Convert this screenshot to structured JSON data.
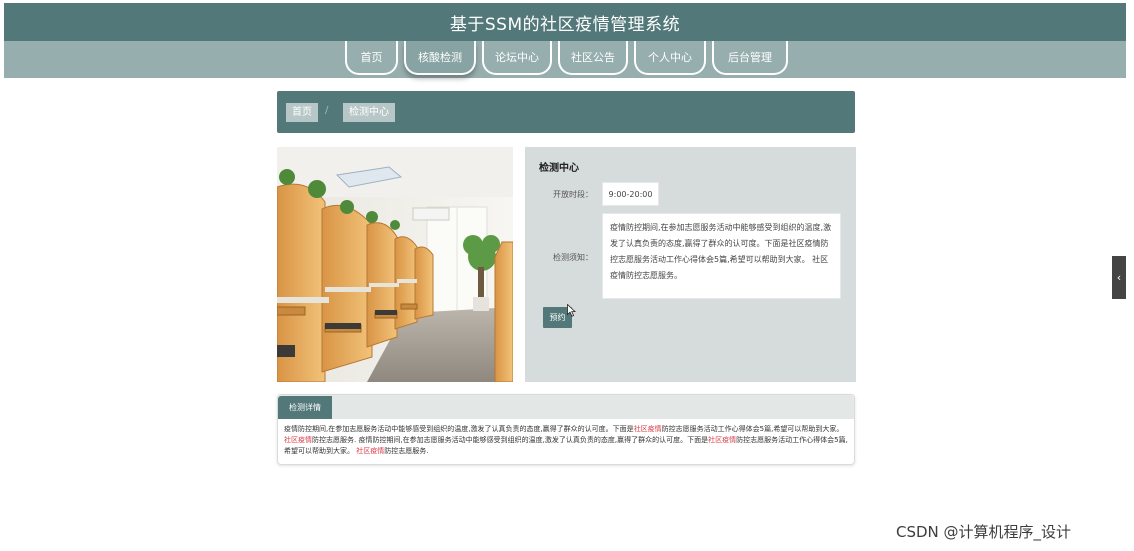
{
  "header": {
    "title": "基于SSM的社区疫情管理系统"
  },
  "nav": {
    "items": [
      {
        "label": "首页",
        "active": false
      },
      {
        "label": "核酸检测",
        "active": true
      },
      {
        "label": "论坛中心",
        "active": false
      },
      {
        "label": "社区公告",
        "active": false
      },
      {
        "label": "个人中心",
        "active": false
      },
      {
        "label": "后台管理",
        "active": false
      }
    ]
  },
  "breadcrumb": {
    "home": "首页",
    "separator": "/",
    "current": "检测中心"
  },
  "info": {
    "title": "检测中心",
    "hours_label": "开放时段：",
    "hours_value": "9:00-20:00",
    "notice_label": "检测须知：",
    "notice_value": "疫情防控期间,在参加志愿服务活动中能够感受到组织的温度,激发了认真负责的态度,赢得了群众的认可度。下面是社区疫情防控志愿服务活动工作心得体会5篇,希望可以帮助到大家。 社区疫情防控志愿服务。",
    "book_button": "预约"
  },
  "detail": {
    "tab_label": "检测详情",
    "segments": [
      "疫情防控期间,在参加志愿服务活动中能够感受到组织的温度,激发了认真负责的态度,赢得了群众的认可度。下面是",
      "社区疫情",
      "防控志愿服务活动工作心得体会5篇,希望可以帮助到大家。 ",
      "社区疫情",
      "防控志愿服务. 疫情防控期间,在参加志愿服务活动中能够感受到组织的温度,激发了认真负责的态度,赢得了群众的认可度。下面是",
      "社区疫情",
      "防控志愿服务活动工作心得体会5篇,希望可以帮助到大家。 ",
      "社区疫情",
      "防控志愿服务."
    ]
  },
  "side_toggle": {
    "icon": "chevron-left-icon",
    "glyph": "‹"
  },
  "watermark": "CSDN @计算机程序_设计",
  "colors": {
    "primary": "#537879",
    "nav_bg": "#96aeae",
    "panel_bg": "#d6dcdb",
    "highlight": "#d9363e"
  }
}
